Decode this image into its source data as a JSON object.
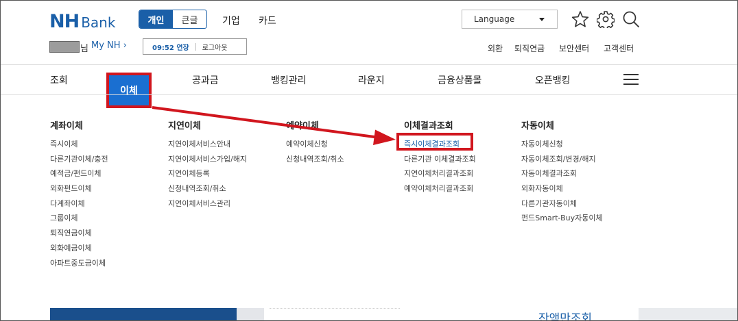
{
  "header": {
    "logo_nh": "NH",
    "logo_bank": "Bank",
    "segment": [
      "개인",
      "큰글"
    ],
    "topnav": [
      "기업",
      "카드"
    ],
    "language": "Language",
    "icons": [
      "star-icon",
      "gear-icon",
      "search-icon"
    ]
  },
  "user": {
    "suffix": "님",
    "my_nh": "My NH ›",
    "session_time": "09:52 연장",
    "logout": "로그아웃"
  },
  "util_links": [
    "외환",
    "퇴직연금",
    "보안센터",
    "고객센터"
  ],
  "gnb": {
    "items": [
      "조회",
      "이체",
      "공과금",
      "뱅킹관리",
      "라운지",
      "금융상품몰",
      "오픈뱅킹"
    ],
    "active": "이체"
  },
  "submenu": [
    {
      "title": "계좌이체",
      "items": [
        "즉시이체",
        "다른기관이체/충전",
        "예적금/펀드이체",
        "외화펀드이체",
        "다계좌이체",
        "그룹이체",
        "퇴직연금이체",
        "외화예금이체",
        "아파트중도금이체"
      ]
    },
    {
      "title": "지연이체",
      "items": [
        "지연이체서비스안내",
        "지연이체서비스가입/해지",
        "지연이체등록",
        "신청내역조회/취소",
        "지연이체서비스관리"
      ]
    },
    {
      "title": "예약이체",
      "items": [
        "예약이체신청",
        "신청내역조회/취소"
      ]
    },
    {
      "title": "이체결과조회",
      "items": [
        "즉시이체결과조회",
        "다른기관 이체결과조회",
        "지연이체처리결과조회",
        "예약이체처리결과조회"
      ]
    },
    {
      "title": "자동이체",
      "items": [
        "자동이체신청",
        "자동이체조회/변경/해지",
        "자동이체결과조회",
        "외화자동이체",
        "다른기관자동이체",
        "펀드Smart-Buy자동이체"
      ]
    }
  ],
  "highlight": {
    "column": 3,
    "item": 0
  },
  "bottom_text": "잔액만조회",
  "colors": {
    "brand": "#1a5fa8",
    "active_menu": "#1a6fd1",
    "annotation_red": "#d1161e"
  }
}
